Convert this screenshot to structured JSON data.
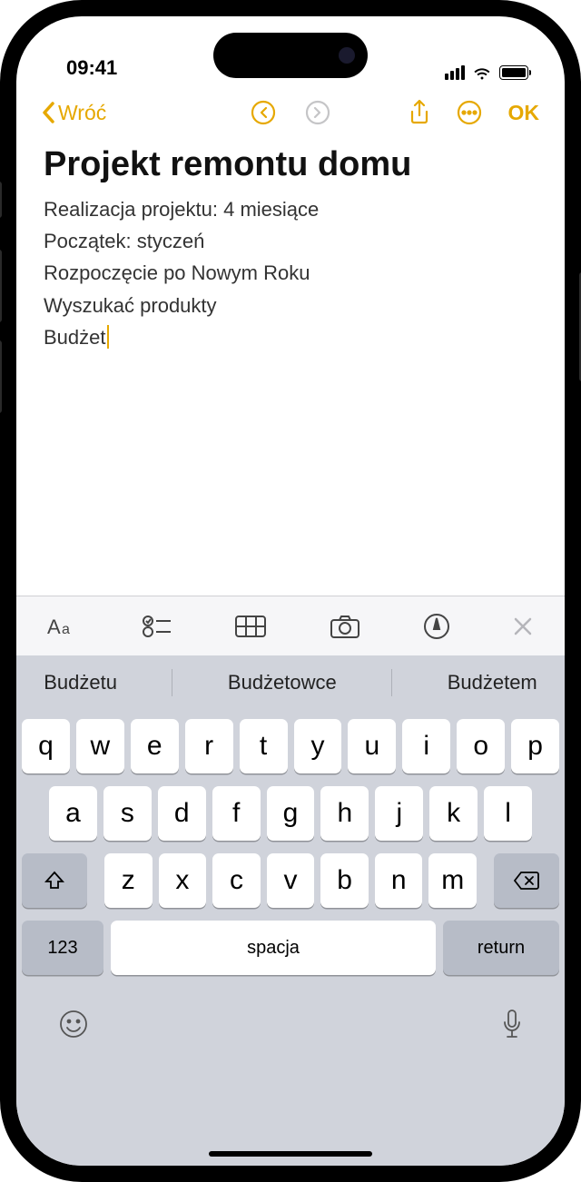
{
  "status": {
    "time": "09:41"
  },
  "nav": {
    "back_label": "Wróć",
    "ok_label": "OK"
  },
  "note": {
    "title": "Projekt remontu domu",
    "lines": [
      "Realizacja projektu: 4 miesiące",
      "Początek: styczeń",
      "Rozpoczęcie po Nowym Roku",
      "Wyszukać produkty",
      "Budżet"
    ]
  },
  "suggestions": {
    "items": [
      "Budżetu",
      "Budżetowce",
      "Budżetem"
    ]
  },
  "keyboard": {
    "row1": [
      "q",
      "w",
      "e",
      "r",
      "t",
      "y",
      "u",
      "i",
      "o",
      "p"
    ],
    "row2": [
      "a",
      "s",
      "d",
      "f",
      "g",
      "h",
      "j",
      "k",
      "l"
    ],
    "row3": [
      "z",
      "x",
      "c",
      "v",
      "b",
      "n",
      "m"
    ],
    "numbers_label": "123",
    "space_label": "spacja",
    "return_label": "return"
  }
}
